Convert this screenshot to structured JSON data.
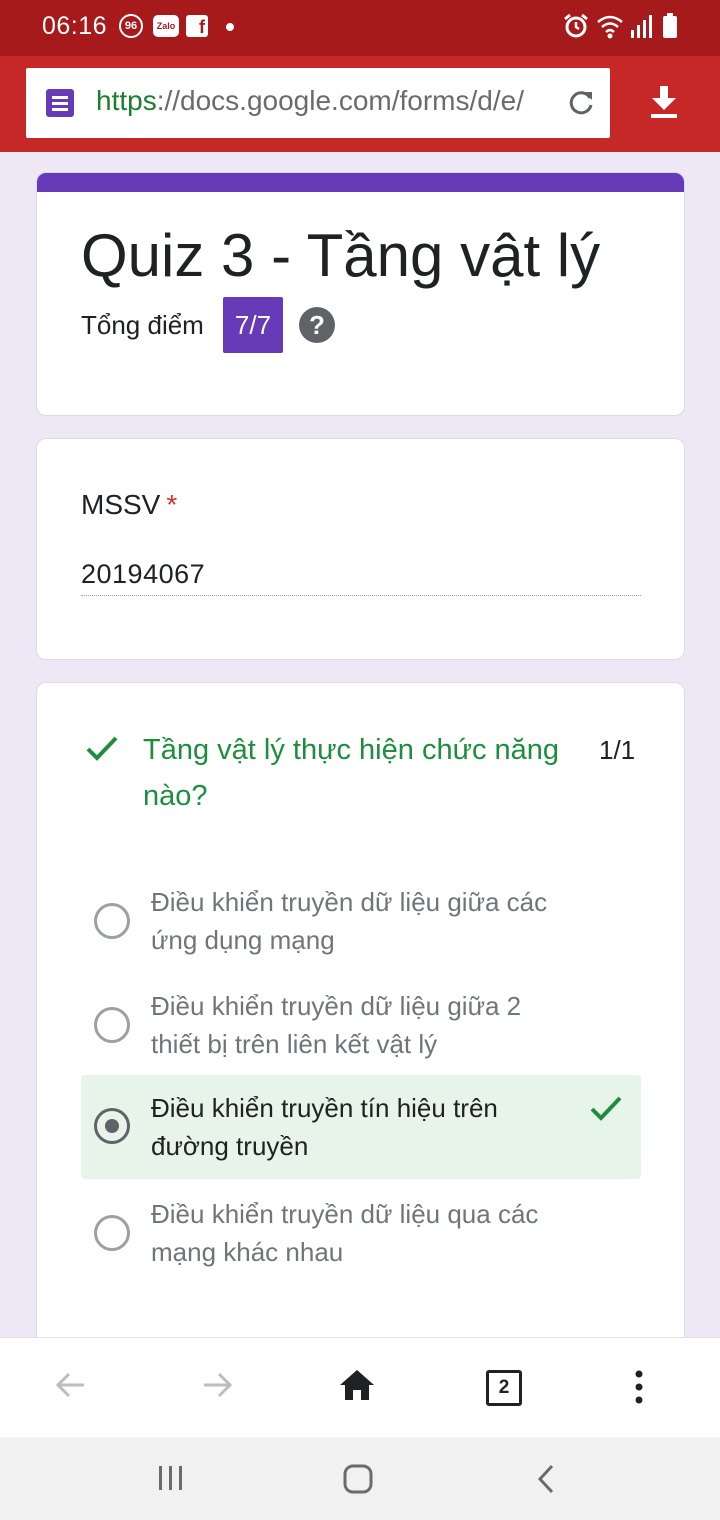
{
  "status_bar": {
    "time": "06:16",
    "notification_badge": "96",
    "zalo_label": "Zalo",
    "fb_label": "f"
  },
  "browser": {
    "url_scheme": "https",
    "url_rest": "://docs.google.com/forms/d/e/",
    "tabs_count": "2"
  },
  "form": {
    "title": "Quiz 3 - Tầng vật lý",
    "score_label": "Tổng điểm",
    "score_value": "7/7",
    "help_symbol": "?"
  },
  "mssv": {
    "label": "MSSV",
    "required_mark": "*",
    "value": "20194067"
  },
  "question": {
    "text": "Tầng vật lý thực hiện chức năng nào?",
    "points": "1/1",
    "options": [
      {
        "label": "Điều khiển truyền dữ liệu giữa các ứng dụng mạng",
        "selected": false,
        "correct": false
      },
      {
        "label": "Điều khiển truyền dữ liệu giữa 2 thiết bị trên liên kết vật lý",
        "selected": false,
        "correct": false
      },
      {
        "label": "Điều khiển truyền tín hiệu trên đường truyền",
        "selected": true,
        "correct": true
      },
      {
        "label": "Điều khiển truyền dữ liệu qua các mạng khác nhau",
        "selected": false,
        "correct": false
      }
    ]
  },
  "colors": {
    "status_bar": "#a71a1c",
    "toolbar": "#c62828",
    "accent": "#673ab7",
    "correct_green": "#1e8e3e",
    "correct_bg": "#e6f4ea",
    "page_bg": "#ede7f6"
  },
  "icons": [
    "forms-icon",
    "reload-icon",
    "download-icon",
    "help-icon",
    "check-icon",
    "back-arrow-icon",
    "forward-arrow-icon",
    "home-icon",
    "menu-dots-icon",
    "recent-apps-icon",
    "home-nav-icon",
    "back-nav-icon",
    "alarm-icon",
    "wifi-icon",
    "signal-icon",
    "battery-icon"
  ]
}
